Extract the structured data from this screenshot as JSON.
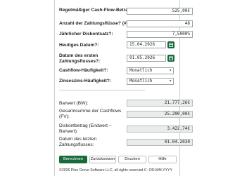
{
  "form": {
    "cashflow_label": "Regelmäßiger Cash-Flow-Betrag?:",
    "cashflow_value": "525,00€",
    "payments_label": "Anzahl der Zahlungsflüsse? (#):",
    "payments_value": "48",
    "rate_label": "Jährlicher Diskontsatz?:",
    "rate_value": "7,5000%",
    "today_label": "Heutiges Datum?:",
    "today_value": "15.04.2026",
    "first_date_label": "Datum des ersten Zahlungsflusses?:",
    "first_date_value": "01.05.2026",
    "frequency_label": "Cashflow-Häufigkeit?:",
    "frequency_value": "Monatlich",
    "compounding_label": "Zinseszins-Häufigkeit?:",
    "compounding_value": "Monatlich"
  },
  "results": {
    "pv_label": "Barwert (BW):",
    "pv_value": "21.777,26€",
    "total_label": "Gesamtsumme der Cashflows (FV):",
    "total_value": "25.200,00€",
    "discount_label": "Diskontbetrag (Endwert – Barwert):",
    "discount_value": "3.422,74€",
    "last_date_label": "Datum des letzten Zahlungsflusses:",
    "last_date_value": "01.04.2030"
  },
  "buttons": {
    "calculate": "Berechnen",
    "reset": "Zurücksetzen",
    "print": "Drucken",
    "help": "Hilfe"
  },
  "footer": {
    "text": "©2026 Pine Grove Software LLC, all rights reserved  €  :  DD.MM.YYYY"
  },
  "icons": {
    "calendar": "calendar-icon",
    "dropdown": "chevron-down-icon"
  },
  "colors": {
    "accent": "#176a3a"
  }
}
